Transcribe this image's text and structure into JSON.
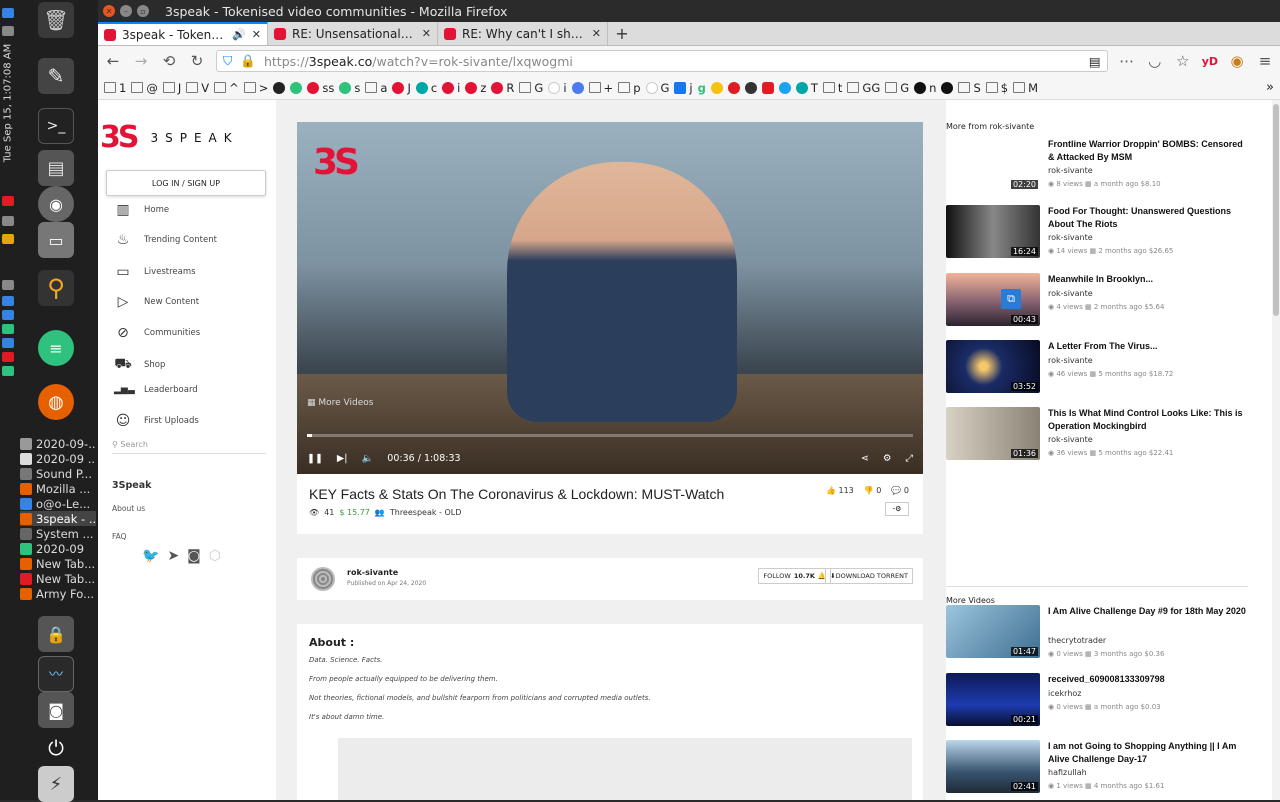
{
  "os": {
    "clock": "Tue Sep 15, 1:07:08 AM",
    "windows": [
      {
        "label": "2020-09-...",
        "color": "#999"
      },
      {
        "label": "2020-09 ...",
        "color": "#ddd"
      },
      {
        "label": "Sound P...",
        "color": "#777"
      },
      {
        "label": "Mozilla ...",
        "color": "#e66000"
      },
      {
        "label": "o@o-Le...",
        "color": "#3584e4"
      },
      {
        "label": "3speak - ...",
        "color": "#e66000"
      },
      {
        "label": "System ...",
        "color": "#666"
      },
      {
        "label": "2020-09",
        "color": "#2ec27e"
      },
      {
        "label": "New Tab...",
        "color": "#e66000"
      },
      {
        "label": "New Tab...",
        "color": "#e01b24"
      },
      {
        "label": "Army Fo...",
        "color": "#e66000"
      }
    ]
  },
  "browser": {
    "window_title": "3speak - Tokenised video communities - Mozilla Firefox",
    "tabs": [
      {
        "label": "3speak - Tokenised vi",
        "color": "#e31337"
      },
      {
        "label": "RE: Unsensationalize Yo",
        "color": "#e31337"
      },
      {
        "label": "RE: Why can't I share Hi",
        "color": "#e31337"
      }
    ],
    "url_prefix": "https://",
    "url_host": "3speak.co",
    "url_path": "/watch?v=rok-sivante/lxqwogmi",
    "ext_label": "yD",
    "bookmarks": [
      "1",
      "@",
      "J",
      "V",
      "^",
      ">",
      "",
      "",
      "ss",
      "s",
      "a",
      "J",
      "c",
      "i",
      "z",
      "R",
      "G",
      "i",
      "",
      "+",
      "p",
      "G",
      "j",
      "g",
      "",
      "",
      "",
      "",
      "",
      "T",
      "t",
      "GG",
      "G",
      "n",
      "",
      "S",
      "$",
      "M"
    ]
  },
  "site": {
    "logo_word": "3SPEAK",
    "logo_mark": "3S",
    "login_label": "LOG IN / SIGN UP",
    "nav": [
      {
        "label": "Home",
        "icon": "home-icon",
        "glyph": "▥"
      },
      {
        "label": "Trending Content",
        "icon": "fire-icon",
        "glyph": "♨"
      },
      {
        "label": "Livestreams",
        "icon": "camera-icon",
        "glyph": "▭"
      },
      {
        "label": "New Content",
        "icon": "play-icon",
        "glyph": "▷"
      },
      {
        "label": "Communities",
        "icon": "globe-icon",
        "glyph": "⊘"
      },
      {
        "label": "Shop",
        "icon": "cart-icon",
        "glyph": "⛟"
      },
      {
        "label": "Leaderboard",
        "icon": "bars-icon",
        "glyph": "▂▅▃"
      },
      {
        "label": "First Uploads",
        "icon": "smile-icon",
        "glyph": "☺"
      }
    ],
    "search_placeholder": "Search",
    "section_label": "3Speak",
    "about_us": "About us",
    "faq": "FAQ"
  },
  "video": {
    "more_videos": "More Videos",
    "time_current": "00:36",
    "time_sep": "/",
    "time_total": "1:08:33",
    "progress": 0.009,
    "title": "KEY Facts & Stats On The Coronavirus & Lockdown: MUST-Watch",
    "views": "41",
    "payout": "$ 15.77",
    "community": "Threespeak - OLD",
    "upvotes": "113",
    "downvotes": "0",
    "comments": "0"
  },
  "author": {
    "name": "rok-sivante",
    "published": "Published on Apr 24, 2020",
    "follow_label": "FOLLOW",
    "followers": "10.7K",
    "torrent_label": "DOWNLOAD TORRENT"
  },
  "about": {
    "heading": "About :",
    "lines": [
      "Data. Science. Facts.",
      "From people actually equipped to be delivering them.",
      "Not theories, fictional models, and bullshit fearporn from politicians and corrupted media outlets.",
      "It's about damn time."
    ]
  },
  "more_from": {
    "heading": "More from rok-sivante",
    "items": [
      {
        "title": "Frontline Warrior Droppin' BOMBS: Censored & Attacked By MSM",
        "author": "rok-sivante",
        "views": "8 views",
        "age": "a month ago",
        "payout": "$8.10",
        "duration": "02:20",
        "thumb": "#ffffff"
      },
      {
        "title": "Food For Thought: Unanswered Questions About The Riots",
        "author": "rok-sivante",
        "views": "14 views",
        "age": "2 months ago",
        "payout": "$26.65",
        "duration": "16:24",
        "thumb": "#444444"
      },
      {
        "title": "Meanwhile In Brooklyn...",
        "author": "rok-sivante",
        "views": "4 views",
        "age": "2 months ago",
        "payout": "$5.64",
        "duration": "00:43",
        "thumb": "#c08a78"
      },
      {
        "title": "A Letter From The Virus...",
        "author": "rok-sivante",
        "views": "46 views",
        "age": "5 months ago",
        "payout": "$18.72",
        "duration": "03:52",
        "thumb": "#101a3a"
      },
      {
        "title": "This Is What Mind Control Looks Like: This is Operation Mockingbird",
        "author": "rok-sivante",
        "views": "36 views",
        "age": "5 months ago",
        "payout": "$22.41",
        "duration": "01:36",
        "thumb": "#b9b3a6"
      }
    ]
  },
  "more_videos": {
    "heading": "More Videos",
    "items": [
      {
        "title": "I Am Alive Challenge Day #9 for 18th May 2020",
        "author": "thecrytotrader",
        "views": "0 views",
        "age": "3 months ago",
        "payout": "$0.36",
        "duration": "01:47",
        "thumb": "#6a9ab8"
      },
      {
        "title": "received_609008133309798",
        "author": "icekrhoz",
        "views": "0 views",
        "age": "a month ago",
        "payout": "$0.03",
        "duration": "00:21",
        "thumb": "#1d2a6a"
      },
      {
        "title": "I am not Going to Shopping Anything || I Am Alive Challenge Day-17",
        "author": "hafizullah",
        "views": "1 views",
        "age": "4 months ago",
        "payout": "$1.61",
        "duration": "02:41",
        "thumb": "#223344"
      }
    ]
  }
}
